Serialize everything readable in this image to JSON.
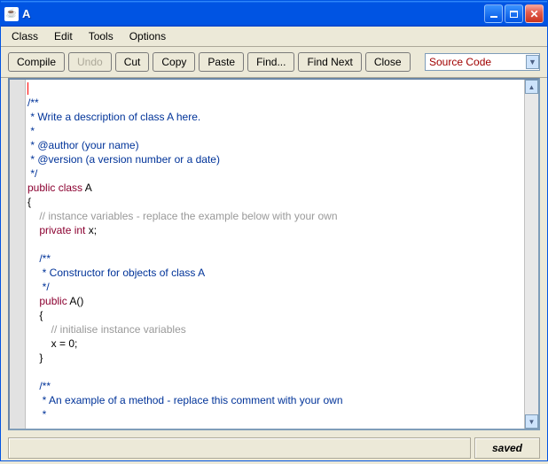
{
  "window": {
    "title": "A"
  },
  "menubar": {
    "items": [
      "Class",
      "Edit",
      "Tools",
      "Options"
    ]
  },
  "toolbar": {
    "compile": "Compile",
    "undo": "Undo",
    "cut": "Cut",
    "copy": "Copy",
    "paste": "Paste",
    "find": "Find...",
    "find_next": "Find Next",
    "close": "Close"
  },
  "view_select": {
    "selected": "Source Code"
  },
  "source": {
    "lines": [
      {
        "cls": "plain",
        "text": ""
      },
      {
        "cls": "doc",
        "text": "/**"
      },
      {
        "cls": "doc",
        "text": " * Write a description of class A here."
      },
      {
        "cls": "doc",
        "text": " * "
      },
      {
        "cls": "doc",
        "text": " * @author (your name) "
      },
      {
        "cls": "doc",
        "text": " * @version (a version number or a date)"
      },
      {
        "cls": "doc",
        "text": " */"
      },
      {
        "cls": "decl",
        "kw1": "public",
        "kw2": "class",
        "rest": " A"
      },
      {
        "cls": "plain",
        "text": "{"
      },
      {
        "cls": "cmt",
        "text": "    // instance variables - replace the example below with your own"
      },
      {
        "cls": "decl2",
        "indent": "    ",
        "kw1": "private",
        "kw2": "int",
        "rest": " x;"
      },
      {
        "cls": "plain",
        "text": ""
      },
      {
        "cls": "doc",
        "text": "    /**"
      },
      {
        "cls": "doc",
        "text": "     * Constructor for objects of class A"
      },
      {
        "cls": "doc",
        "text": "     */"
      },
      {
        "cls": "decl3",
        "indent": "    ",
        "kw1": "public",
        "rest": " A()"
      },
      {
        "cls": "plain",
        "text": "    {"
      },
      {
        "cls": "cmt",
        "text": "        // initialise instance variables"
      },
      {
        "cls": "plain",
        "text": "        x = 0;"
      },
      {
        "cls": "plain",
        "text": "    }"
      },
      {
        "cls": "plain",
        "text": ""
      },
      {
        "cls": "doc",
        "text": "    /**"
      },
      {
        "cls": "doc",
        "text": "     * An example of a method - replace this comment with your own"
      },
      {
        "cls": "doc",
        "text": "     * "
      }
    ]
  },
  "status": {
    "message": "",
    "state": "saved"
  }
}
